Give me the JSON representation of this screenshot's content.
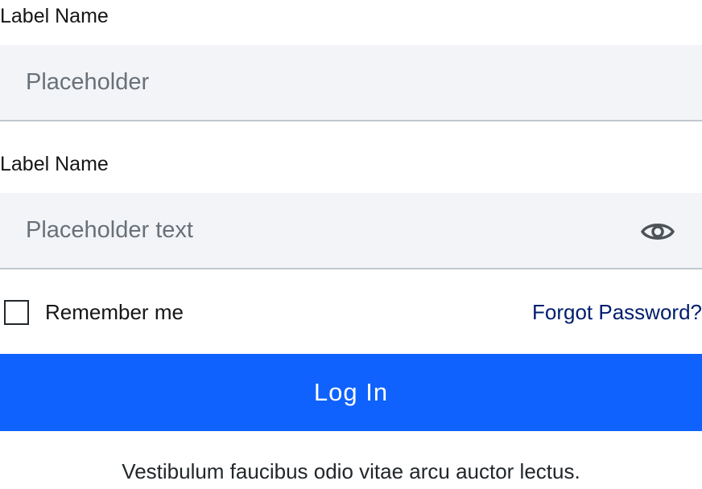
{
  "form": {
    "field_1": {
      "label": "Label Name",
      "value": "",
      "placeholder": "Placeholder"
    },
    "field_2": {
      "label": "Label Name",
      "value": "",
      "placeholder": "Placeholder text",
      "toggle_icon": "eye-icon"
    },
    "remember": {
      "label": "Remember me",
      "checked": false
    },
    "forgot_password": "Forgot Password?",
    "submit_label": "Log In",
    "footer_text": "Vestibulum faucibus odio vitae arcu auctor lectus."
  },
  "colors": {
    "primary": "#0f62fe",
    "link": "#001d6c",
    "input_background": "#f2f4f8",
    "input_border": "#c1c7cd",
    "placeholder": "#697077",
    "text": "#161616"
  }
}
